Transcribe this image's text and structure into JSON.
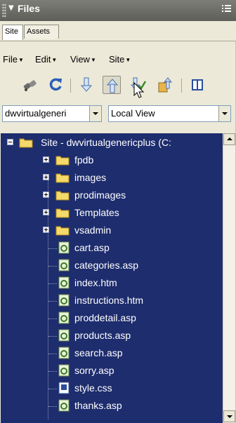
{
  "panel": {
    "title": "Files",
    "colors": {
      "titlebar": "#6b6b65",
      "tree_selection": "#1e2d6e",
      "panel_bg": "#ece9d8"
    }
  },
  "tabs": [
    {
      "label": "Site",
      "active": true
    },
    {
      "label": "Assets",
      "active": false
    }
  ],
  "menus": [
    {
      "label": "File"
    },
    {
      "label": "Edit"
    },
    {
      "label": "View"
    },
    {
      "label": "Site"
    }
  ],
  "toolbar": {
    "buttons": [
      {
        "icon": "connect-icon"
      },
      {
        "icon": "refresh-icon"
      },
      {
        "icon": "get-files-icon"
      },
      {
        "icon": "put-files-icon",
        "pressed": true
      },
      {
        "icon": "check-out-icon"
      },
      {
        "icon": "check-in-icon"
      },
      {
        "icon": "expand-icon"
      }
    ]
  },
  "site_select": {
    "value": "dwvirtualgeneri"
  },
  "view_select": {
    "value": "Local View"
  },
  "tree": {
    "root": {
      "label": "Site - dwvirtualgenericplus (C:",
      "expanded": true
    },
    "folders": [
      {
        "label": "fpdb"
      },
      {
        "label": "images"
      },
      {
        "label": "prodimages"
      },
      {
        "label": "Templates"
      },
      {
        "label": "vsadmin"
      }
    ],
    "files": [
      {
        "label": "cart.asp",
        "icon": "asp-file-icon"
      },
      {
        "label": "categories.asp",
        "icon": "asp-file-icon"
      },
      {
        "label": "index.htm",
        "icon": "htm-file-icon"
      },
      {
        "label": "instructions.htm",
        "icon": "htm-file-icon"
      },
      {
        "label": "proddetail.asp",
        "icon": "asp-file-icon"
      },
      {
        "label": "products.asp",
        "icon": "asp-file-icon"
      },
      {
        "label": "search.asp",
        "icon": "asp-file-icon"
      },
      {
        "label": "sorry.asp",
        "icon": "asp-file-icon"
      },
      {
        "label": "style.css",
        "icon": "css-file-icon"
      },
      {
        "label": "thanks.asp",
        "icon": "asp-file-icon"
      }
    ]
  }
}
